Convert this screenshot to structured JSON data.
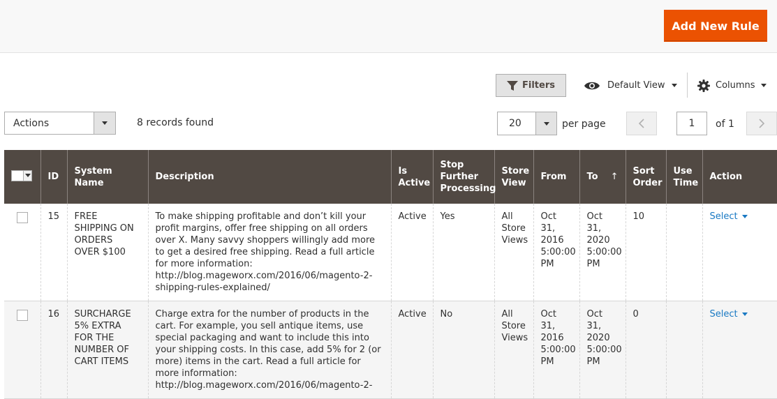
{
  "header": {
    "add_button": "Add New Rule"
  },
  "toolbar": {
    "filters": "Filters",
    "view": "Default View",
    "columns": "Columns",
    "actions": "Actions",
    "records": "8 records found",
    "per_page_value": "20",
    "per_page_label": "per page",
    "page_value": "1",
    "page_of": "of 1"
  },
  "table": {
    "columns": [
      "ID",
      "System Name",
      "Description",
      "Is Active",
      "Stop Further Processing",
      "Store View",
      "From",
      "To",
      "Sort Order",
      "Use Time",
      "Action"
    ],
    "sort_indicator": "↑",
    "rows": [
      {
        "id": "15",
        "name": "FREE SHIPPING ON ORDERS OVER $100",
        "description": "To make shipping profitable and don’t kill your profit margins, offer free shipping on all orders over X. Many savvy shoppers willingly add more to get a desired free shipping.  Read a full article for more information: http://blog.mageworx.com/2016/06/magento-2-shipping-rules-explained/",
        "active": "Active",
        "stop": "Yes",
        "store": "All Store Views",
        "from": "Oct 31, 2016 5:00:00 PM",
        "to": "Oct 31, 2020 5:00:00 PM",
        "sort": "10",
        "use_time": "",
        "action": "Select"
      },
      {
        "id": "16",
        "name": "SURCHARGE 5% EXTRA FOR THE NUMBER OF CART ITEMS",
        "description": "Charge extra for the number of products in the cart. For example, you sell antique items, use special packaging and want to include this into your shipping costs. In this case, add 5% for 2 (or more) items in the cart.  Read a full article for more information: http://blog.mageworx.com/2016/06/magento-2-",
        "active": "Active",
        "stop": "No",
        "store": "All Store Views",
        "from": "Oct 31, 2016 5:00:00 PM",
        "to": "Oct 31, 2020 5:00:00 PM",
        "sort": "0",
        "use_time": "",
        "action": "Select"
      }
    ]
  }
}
